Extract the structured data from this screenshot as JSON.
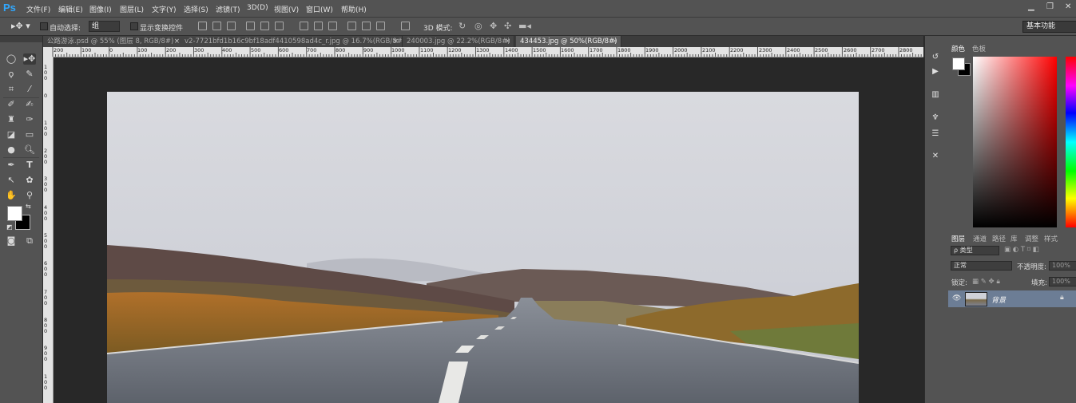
{
  "app": {
    "logo": "Ps"
  },
  "menu": [
    "文件(F)",
    "编辑(E)",
    "图像(I)",
    "图层(L)",
    "文字(Y)",
    "选择(S)",
    "滤镜(T)",
    "3D(D)",
    "视图(V)",
    "窗口(W)",
    "帮助(H)"
  ],
  "window_controls": {
    "minimize": "▁",
    "restore": "❐",
    "close": "✕"
  },
  "options": {
    "auto_select_label": "自动选择:",
    "auto_select_value": "组",
    "show_transform_label": "显示变换控件",
    "mode_3d_label": "3D 模式:",
    "workspace": "基本功能"
  },
  "tabs": [
    {
      "label": "公路游泳.psd @ 55% (图层 8, RGB/8#)",
      "close": "×",
      "active": false
    },
    {
      "label": "v2-7721bfd1b16c9bf18adf4410598ad4c_r.jpg @ 16.7%(RGB/8#)",
      "close": "×",
      "active": false
    },
    {
      "label": "240003.jpg @ 22.2%(RGB/8#)",
      "close": "×",
      "active": false
    },
    {
      "label": "434453.jpg @ 50%(RGB/8#)",
      "close": "×",
      "active": true
    }
  ],
  "ruler_h_labels": [
    "200",
    "100",
    "0",
    "100",
    "200",
    "300",
    "400",
    "500",
    "600",
    "700",
    "800",
    "900",
    "1000",
    "1100",
    "1200",
    "1300",
    "1400",
    "1500",
    "1600",
    "1700",
    "1800",
    "1900",
    "2000",
    "2100",
    "2200",
    "2300",
    "2400",
    "2500",
    "2600",
    "2700",
    "2800"
  ],
  "ruler_v_labels": [
    "1\n0\n0",
    "0",
    "1\n0\n0",
    "2\n0\n0",
    "3\n0\n0",
    "4\n0\n0",
    "5\n0\n0",
    "6\n0\n0",
    "7\n0\n0",
    "8\n0\n0",
    "9\n0\n0",
    "1\n0\n0"
  ],
  "panels": {
    "color_tabs": [
      "颜色",
      "色板"
    ],
    "layer_tabs": [
      "图层",
      "通道",
      "路径",
      "库",
      "调整",
      "样式"
    ],
    "filter_kind": "ρ 类型",
    "blend_mode": "正常",
    "opacity_label": "不透明度:",
    "opacity_value": "100%",
    "lock_label": "锁定:",
    "fill_label": "填充:",
    "fill_value": "100%",
    "layer_name": "背景"
  },
  "colors": {
    "accent": "#31a8ff",
    "panel_bg": "#535353",
    "canvas_bg": "#282828",
    "layer_selected": "#6c7d95"
  }
}
